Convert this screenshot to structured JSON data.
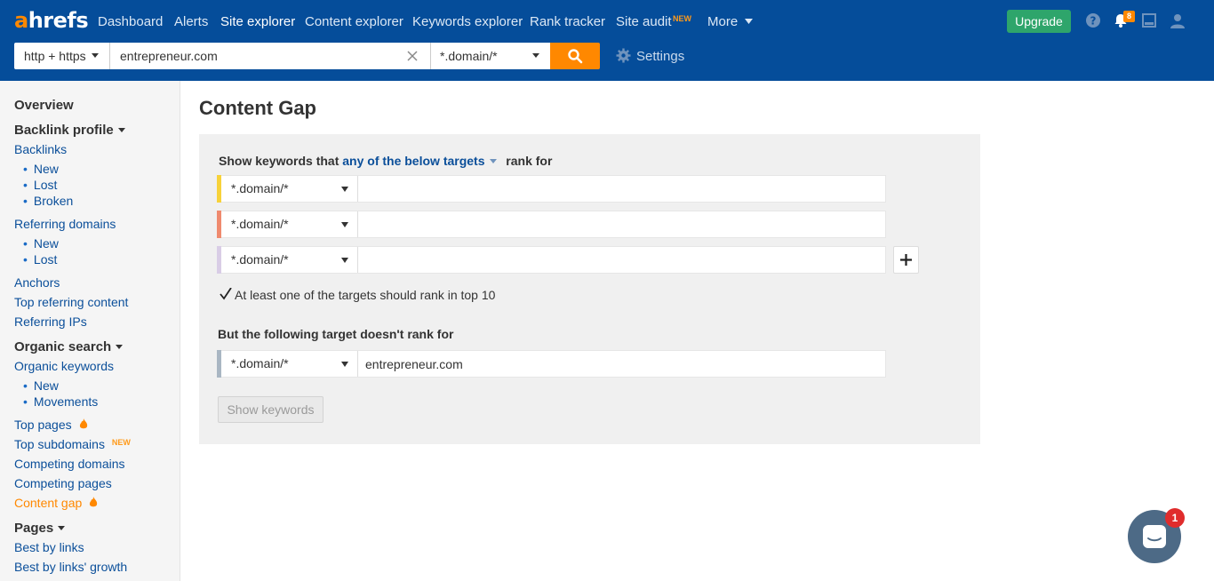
{
  "brand": {
    "a": "a",
    "rest": "hrefs",
    "accent": "#ff8800",
    "header_bg": "#054d9a"
  },
  "nav": [
    {
      "label": "Dashboard"
    },
    {
      "label": "Alerts"
    },
    {
      "label": "Site explorer"
    },
    {
      "label": "Content explorer"
    },
    {
      "label": "Keywords explorer"
    },
    {
      "label": "Rank tracker"
    },
    {
      "label": "Site audit"
    },
    {
      "label": "More"
    }
  ],
  "nav_new_badge": "NEW",
  "header_actions": {
    "upgrade": "Upgrade",
    "notification_count": "8",
    "icons": [
      "help-icon",
      "bell-icon",
      "inbox-icon",
      "user-icon"
    ]
  },
  "search": {
    "protocol": "http + https",
    "value": "entrepreneur.com",
    "mode": "*.domain/*",
    "settings": "Settings"
  },
  "sidebar": {
    "overview": "Overview",
    "backlink_profile": "Backlink profile",
    "backlinks": "Backlinks",
    "backlinks_sub": [
      "New",
      "Lost",
      "Broken"
    ],
    "referring_domains": "Referring domains",
    "referring_domains_sub": [
      "New",
      "Lost"
    ],
    "anchors": "Anchors",
    "top_referring_content": "Top referring content",
    "referring_ips": "Referring IPs",
    "organic_search": "Organic search",
    "organic_keywords": "Organic keywords",
    "organic_keywords_sub": [
      "New",
      "Movements"
    ],
    "top_pages": "Top pages",
    "top_subdomains": "Top subdomains",
    "new_badge": "NEW",
    "competing_domains": "Competing domains",
    "competing_pages": "Competing pages",
    "content_gap": "Content gap",
    "pages": "Pages",
    "best_by_links": "Best by links",
    "best_by_links_growth": "Best by links' growth"
  },
  "main": {
    "title": "Content Gap",
    "show_prefix": "Show keywords that",
    "show_link": "any of the below targets",
    "show_suffix": "rank for",
    "targets": [
      {
        "mode": "*.domain/*",
        "value": "",
        "color": "#f7d23a"
      },
      {
        "mode": "*.domain/*",
        "value": "",
        "color": "#ef8a6e"
      },
      {
        "mode": "*.domain/*",
        "value": "",
        "color": "#d9cde6"
      }
    ],
    "checkbox_label": "At least one of the targets should rank in top 10",
    "checkbox_checked": true,
    "exclude_label": "But the following target doesn't rank for",
    "exclude_target": {
      "mode": "*.domain/*",
      "value": "entrepreneur.com",
      "color": "#a9b6c3"
    },
    "show_button": "Show keywords"
  },
  "chat": {
    "count": "1"
  }
}
